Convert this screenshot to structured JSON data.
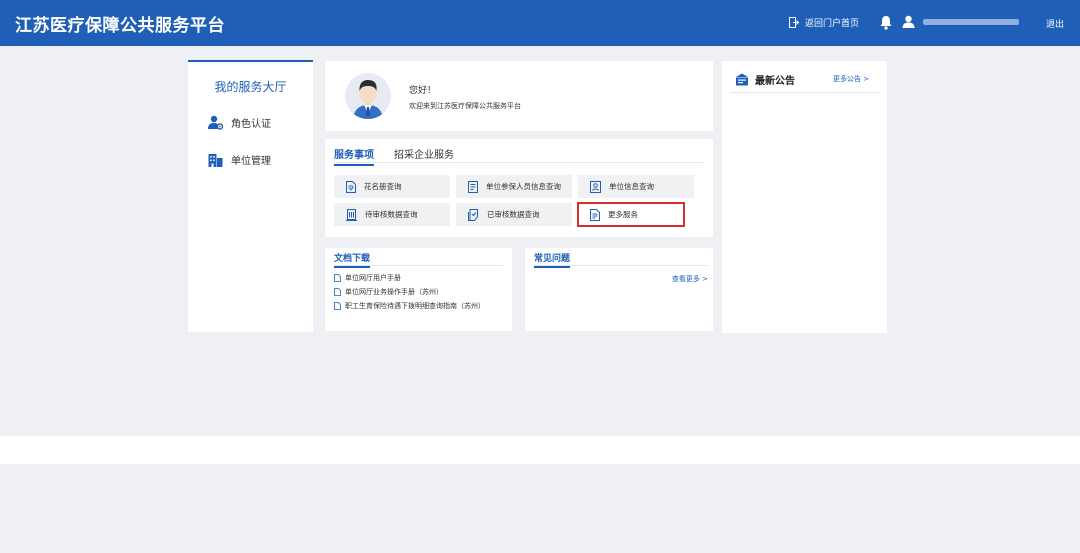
{
  "header": {
    "title": "江苏医疗保障公共服务平台",
    "back_home": "返回门户首页",
    "logout": "退出"
  },
  "sidebar": {
    "title": "我的服务大厅",
    "items": [
      {
        "label": "角色认证",
        "icon": "user-settings-icon"
      },
      {
        "label": "单位管理",
        "icon": "building-icon"
      }
    ]
  },
  "welcome": {
    "greeting": "您好！",
    "message": "欢迎来到江苏医疗保障公共服务平台"
  },
  "services": {
    "tabs": [
      {
        "label": "服务事项",
        "active": true
      },
      {
        "label": "招采企业服务",
        "active": false
      }
    ],
    "items": [
      {
        "label": "花名册查询",
        "icon": "document-edit-icon"
      },
      {
        "label": "单位参保人员信息查询",
        "icon": "document-list-icon"
      },
      {
        "label": "单位信息查询",
        "icon": "id-card-icon"
      },
      {
        "label": "待审核数据查询",
        "icon": "building-columns-icon"
      },
      {
        "label": "已审核数据查询",
        "icon": "document-check-icon"
      },
      {
        "label": "更多服务",
        "icon": "document-more-icon",
        "highlighted": true
      }
    ]
  },
  "docs": {
    "title": "文档下载",
    "items": [
      "单位网厅用户手册",
      "单位网厅业务操作手册（苏州）",
      "职工生育保险待遇下拨明细查询指南（苏州）"
    ]
  },
  "faq": {
    "title": "常见问题",
    "more": "查看更多 >"
  },
  "news": {
    "title": "最新公告",
    "more": "更多公告 >"
  },
  "colors": {
    "primary": "#1f5fb8",
    "highlight_border": "#d32f2f",
    "page_bg": "#eff0f4"
  }
}
